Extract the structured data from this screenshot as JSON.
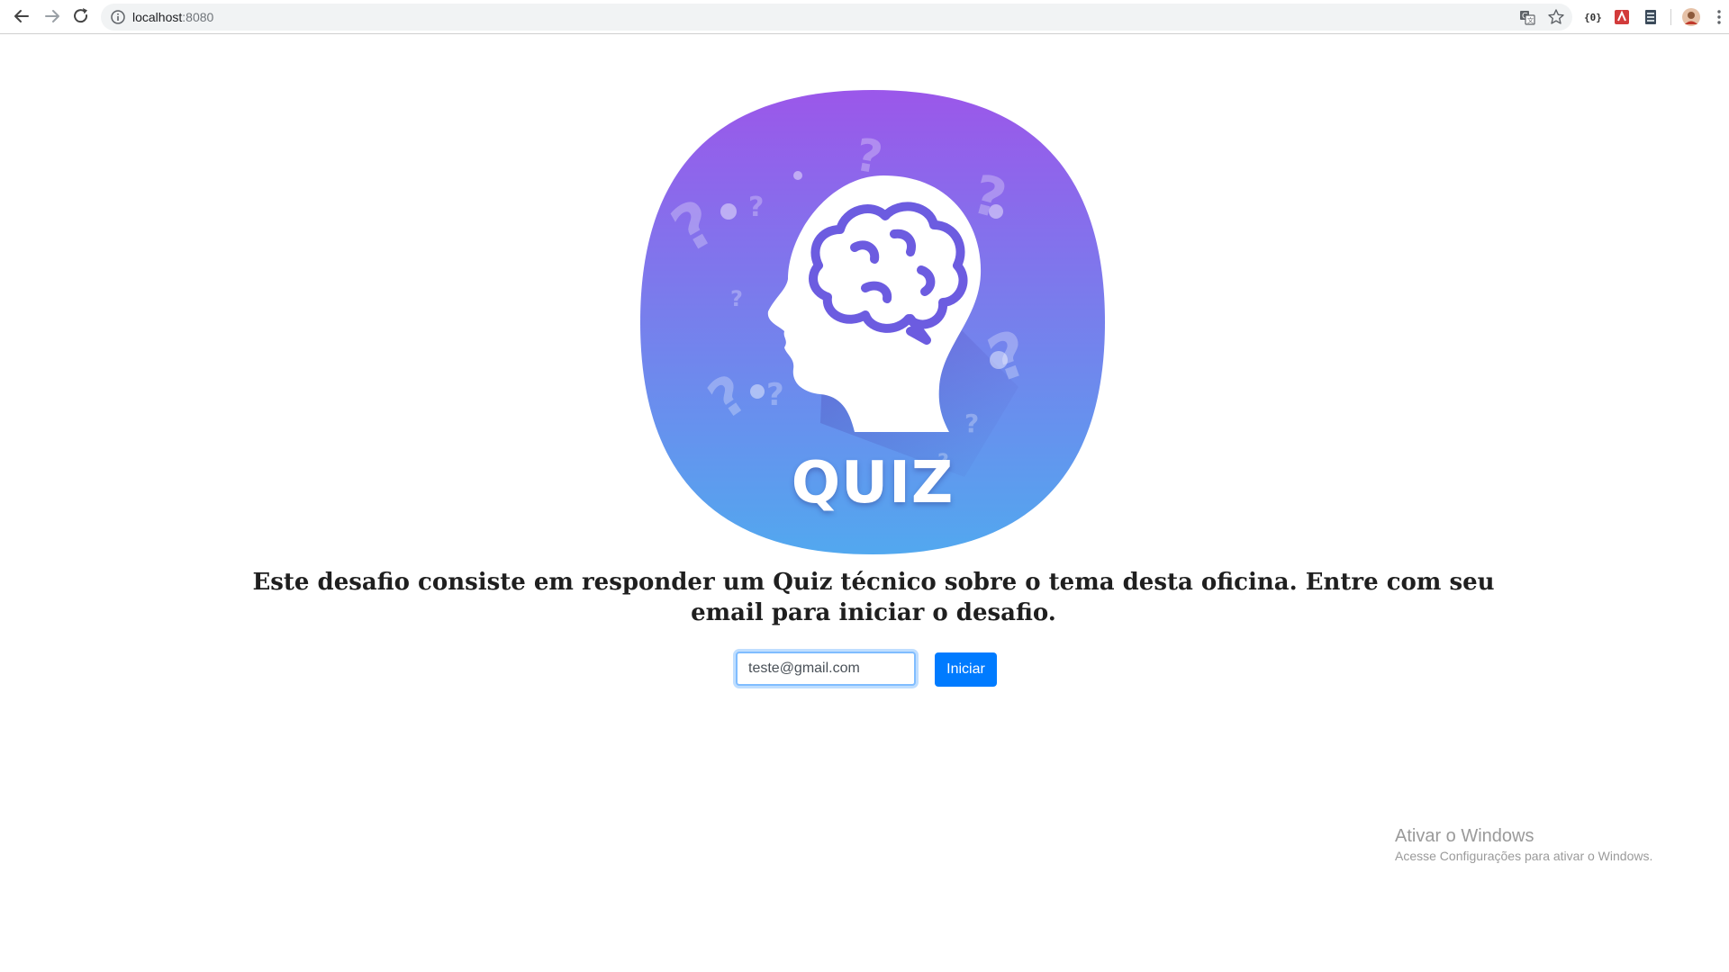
{
  "browser": {
    "url_host": "localhost",
    "url_port": ":8080",
    "icons": [
      "back-icon",
      "forward-icon",
      "reload-icon",
      "info-icon",
      "translate-icon",
      "star-icon",
      "extension-icon",
      "profile-avatar",
      "menu-icon"
    ]
  },
  "logo": {
    "word": "QUIZ",
    "gradient_top": "#9b57ea",
    "gradient_bottom": "#52a8ef",
    "brain_color": "#6c5ce0"
  },
  "main": {
    "description": "Este desafio consiste em responder um Quiz técnico sobre o tema desta oficina. Entre com seu email para iniciar o desafio."
  },
  "form": {
    "email_value": "teste@gmail.com",
    "submit_label": "Iniciar",
    "button_color": "#007bff"
  },
  "watermark": {
    "title": "Ativar o Windows",
    "subtitle": "Acesse Configurações para ativar o Windows."
  }
}
